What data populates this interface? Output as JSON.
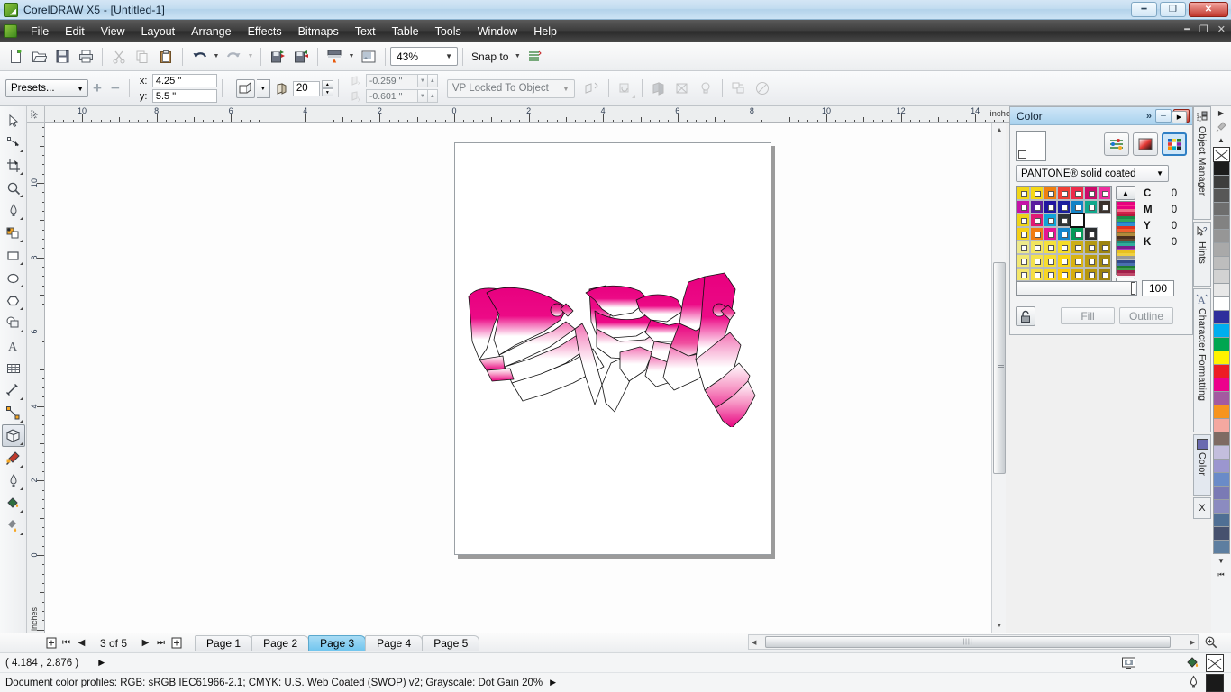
{
  "window": {
    "title": "CorelDRAW X5 - [Untitled-1]",
    "app_icon": "coreldraw-logo-icon",
    "minimize": "minimize-icon",
    "restore": "restore-icon",
    "close": "close-icon"
  },
  "menu": {
    "items": [
      {
        "label": "File",
        "mnemonic": "F"
      },
      {
        "label": "Edit",
        "mnemonic": "E"
      },
      {
        "label": "View",
        "mnemonic": "V"
      },
      {
        "label": "Layout",
        "mnemonic": "L"
      },
      {
        "label": "Arrange",
        "mnemonic": "A"
      },
      {
        "label": "Effects",
        "mnemonic": "c"
      },
      {
        "label": "Bitmaps",
        "mnemonic": "B"
      },
      {
        "label": "Text",
        "mnemonic": "x"
      },
      {
        "label": "Table",
        "mnemonic": "T"
      },
      {
        "label": "Tools",
        "mnemonic": "o"
      },
      {
        "label": "Window",
        "mnemonic": "W"
      },
      {
        "label": "Help",
        "mnemonic": "H"
      }
    ]
  },
  "toolbar": {
    "buttons": [
      {
        "name": "new-document-icon",
        "tip": "New"
      },
      {
        "name": "open-document-icon",
        "tip": "Open"
      },
      {
        "name": "save-document-icon",
        "tip": "Save"
      },
      {
        "name": "print-icon",
        "tip": "Print"
      },
      {
        "name": "cut-icon",
        "tip": "Cut"
      },
      {
        "name": "copy-icon",
        "tip": "Copy"
      },
      {
        "name": "paste-icon",
        "tip": "Paste"
      },
      {
        "name": "undo-icon",
        "tip": "Undo"
      },
      {
        "name": "redo-icon",
        "tip": "Redo"
      },
      {
        "name": "import-icon",
        "tip": "Import"
      },
      {
        "name": "export-icon",
        "tip": "Export"
      },
      {
        "name": "launch-icon",
        "tip": "Application Launcher"
      },
      {
        "name": "corel-connect-icon",
        "tip": "Corel CONNECT"
      }
    ],
    "zoom_level": "43%",
    "snap_to_label": "Snap to",
    "options_icon": "options-icon"
  },
  "property_bar": {
    "presets_label": "Presets...",
    "add_preset_icon": "plus-icon",
    "remove_preset_icon": "minus-icon",
    "x_label": "x:",
    "x_value": "4.25 \"",
    "y_label": "y:",
    "y_value": "5.5 \"",
    "perspective_icon": "perspective-icon",
    "extrude_dropdown_icon": "chevron-down-icon",
    "depth_icon": "depth-icon",
    "depth_value": "20",
    "offset_x_value": "-0.259 \"",
    "offset_y_value": "-0.601 \"",
    "vanishing_point_mode": "VP Locked To Object",
    "copy_props_icon": "copy-properties-icon",
    "right_icons": [
      {
        "name": "extrude-rotation-icon"
      },
      {
        "name": "extrude-color-icon"
      },
      {
        "name": "extrude-bevel-icon"
      },
      {
        "name": "extrude-lighting-icon"
      },
      {
        "name": "duplicate-icon"
      },
      {
        "name": "clear-extrude-icon"
      }
    ]
  },
  "toolbox": {
    "tools": [
      {
        "name": "pick-tool",
        "label": "Pick",
        "flyout": false,
        "active": false
      },
      {
        "name": "shape-tool",
        "label": "Shape",
        "flyout": true,
        "active": false
      },
      {
        "name": "crop-tool",
        "label": "Crop",
        "flyout": true,
        "active": false
      },
      {
        "name": "zoom-tool",
        "label": "Zoom",
        "flyout": true,
        "active": false
      },
      {
        "name": "freehand-tool",
        "label": "Freehand",
        "flyout": true,
        "active": false
      },
      {
        "name": "smart-fill-tool",
        "label": "Smart Fill",
        "flyout": true,
        "active": false
      },
      {
        "name": "rectangle-tool",
        "label": "Rectangle",
        "flyout": true,
        "active": false
      },
      {
        "name": "ellipse-tool",
        "label": "Ellipse",
        "flyout": true,
        "active": false
      },
      {
        "name": "polygon-tool",
        "label": "Polygon",
        "flyout": true,
        "active": false
      },
      {
        "name": "basic-shapes-tool",
        "label": "Basic Shapes",
        "flyout": true,
        "active": false
      },
      {
        "name": "text-tool",
        "label": "Text",
        "flyout": false,
        "active": false
      },
      {
        "name": "table-tool",
        "label": "Table",
        "flyout": false,
        "active": false
      },
      {
        "name": "dimension-tool",
        "label": "Dimension",
        "flyout": true,
        "active": false
      },
      {
        "name": "connector-tool",
        "label": "Connector",
        "flyout": true,
        "active": false
      },
      {
        "name": "extrude-tool",
        "label": "Extrude",
        "flyout": true,
        "active": true
      },
      {
        "name": "eyedropper-tool",
        "label": "Color Eyedropper",
        "flyout": true,
        "active": false
      },
      {
        "name": "outline-tool",
        "label": "Outline",
        "flyout": true,
        "active": false
      },
      {
        "name": "fill-tool",
        "label": "Fill",
        "flyout": true,
        "active": false
      },
      {
        "name": "interactive-fill-tool",
        "label": "Interactive Fill",
        "flyout": true,
        "active": false
      }
    ]
  },
  "rulers": {
    "unit": "inches",
    "horizontal_labels": [
      "10",
      "8",
      "6",
      "4",
      "2",
      "0",
      "2",
      "4",
      "6",
      "8",
      "10",
      "12",
      "14"
    ],
    "vertical_labels": [
      "10",
      "8",
      "6",
      "4",
      "2",
      "0"
    ]
  },
  "document": {
    "page_number": "3 of 5",
    "artwork_name": "riski-graffiti-artwork",
    "artwork_text": "RISKI"
  },
  "page_tabs": {
    "first_icon": "first-page-icon",
    "prev_icon": "previous-page-icon",
    "next_icon": "next-page-icon",
    "last_icon": "last-page-icon",
    "add_page_left_icon": "add-page-before-icon",
    "add_page_right_icon": "add-page-after-icon",
    "counter": "3 of 5",
    "tabs": [
      {
        "label": "Page 1",
        "active": false
      },
      {
        "label": "Page 2",
        "active": false
      },
      {
        "label": "Page 3",
        "active": true
      },
      {
        "label": "Page 4",
        "active": false
      },
      {
        "label": "Page 5",
        "active": false
      }
    ]
  },
  "status": {
    "coordinates": "( 4.184 , 2.876 )",
    "expand_icon": "expand-arrow-icon",
    "color_profiles": "Document color profiles: RGB: sRGB IEC61966-2.1; CMYK: U.S. Web Coated (SWOP) v2; Grayscale: Dot Gain 20%",
    "profiles_arrow_icon": "expand-arrow-icon",
    "monitor_icon": "color-proof-icon",
    "fill_icon": "fill-icon",
    "fill_value": "none",
    "outline_icon": "outline-pen-icon",
    "outline_color": "#1a1a1a"
  },
  "color_docker": {
    "title": "Color",
    "chevron_icon": "chevrons-right-icon",
    "minimize_icon": "minimize-icon",
    "close_icon": "close-icon",
    "expand_icon": "flyout-arrow-icon",
    "current_color": "#ffffff",
    "mode_buttons": [
      {
        "name": "color-sliders-button",
        "selected": false
      },
      {
        "name": "color-viewers-button",
        "selected": false
      },
      {
        "name": "color-palettes-button",
        "selected": true
      }
    ],
    "palette_name": "PANTONE® solid coated",
    "tint_value": "100",
    "lock_icon": "lock-icon",
    "fill_button": "Fill",
    "outline_button": "Outline",
    "channels": [
      {
        "label": "C",
        "value": "0"
      },
      {
        "label": "M",
        "value": "0"
      },
      {
        "label": "Y",
        "value": "0"
      },
      {
        "label": "K",
        "value": "0"
      }
    ],
    "scroll_up_icon": "scroll-up-icon",
    "scroll_down_icon": "scroll-down-icon",
    "swatch_grid": [
      [
        "#f2d617",
        "#f5d815",
        "#f08010",
        "#ef3f35",
        "#ee2b4a",
        "#cc0a6a",
        "#ee2e9e"
      ],
      [
        "#c412a8",
        "#5b1d9e",
        "#2014a0",
        "#1b1f9e",
        "#1383c6",
        "#10a88c",
        "#3a322c"
      ],
      [
        "#efd418",
        "#e01a74",
        "#10a3d8",
        "#2e3436",
        "#ffffff",
        "#ffffff",
        "#ffffff"
      ],
      [
        "#f5d017",
        "#f07c12",
        "#e51593",
        "#1385cc",
        "#049a56",
        "#2b2e30",
        "#ffffff"
      ],
      [
        "#eee98a",
        "#f2e55e",
        "#f4e13c",
        "#f5dc28",
        "#cdae16",
        "#b59a12",
        "#9c8411"
      ],
      [
        "#f2e873",
        "#f3e14d",
        "#f6dd2e",
        "#f9d412",
        "#d8b313",
        "#bd9e12",
        "#a2880f"
      ],
      [
        "#f4e76a",
        "#f5de44",
        "#f8d624",
        "#fbca07",
        "#d6ad0e",
        "#b8970d",
        "#9d820c"
      ]
    ],
    "selected_swatch": {
      "row": 2,
      "col": 4,
      "color": "#ffffff"
    }
  },
  "docker_tabs": [
    {
      "label": "Object Manager",
      "icon": "object-manager-icon",
      "active": false
    },
    {
      "label": "Hints",
      "icon": "hints-icon",
      "active": false
    },
    {
      "label": "Character Formatting",
      "icon": "character-icon",
      "active": false
    },
    {
      "label": "Color",
      "icon": "color-swatch-icon",
      "active": true
    },
    {
      "label": "X",
      "icon": "close-icon",
      "active": false
    }
  ],
  "right_palette": {
    "flyout_icon": "palette-flyout-icon",
    "eyedropper_icon": "eyedropper-icon",
    "scroll_up_icon": "scroll-up-icon",
    "scroll_down_icon": "scroll-down-icon",
    "home_icon": "palette-home-icon",
    "no_color": "none",
    "colors": [
      "#1c1c1c",
      "#3d3d3d",
      "#575757",
      "#6e6e6e",
      "#828282",
      "#969696",
      "#a9a9a9",
      "#bdbdbd",
      "#d2d2d2",
      "#e8e8e8",
      "#ffffff",
      "#2e2e9c",
      "#00aeef",
      "#00a651",
      "#fff200",
      "#ed1c24",
      "#ec008c",
      "#a35aa0",
      "#f7941e",
      "#f4a8a0",
      "#7e6b63",
      "#c3bedd",
      "#9b96cf",
      "#6a8bc8",
      "#7a7ab5",
      "#8b8bc0",
      "#4f6f94",
      "#46516e",
      "#5d7ea0"
    ]
  },
  "scrollbars": {
    "vertical_up_icon": "scroll-up-icon",
    "vertical_down_icon": "scroll-down-icon",
    "horizontal_left_icon": "scroll-left-icon",
    "horizontal_right_icon": "scroll-right-icon",
    "zoom_icon": "zoom-one-shot-icon"
  }
}
